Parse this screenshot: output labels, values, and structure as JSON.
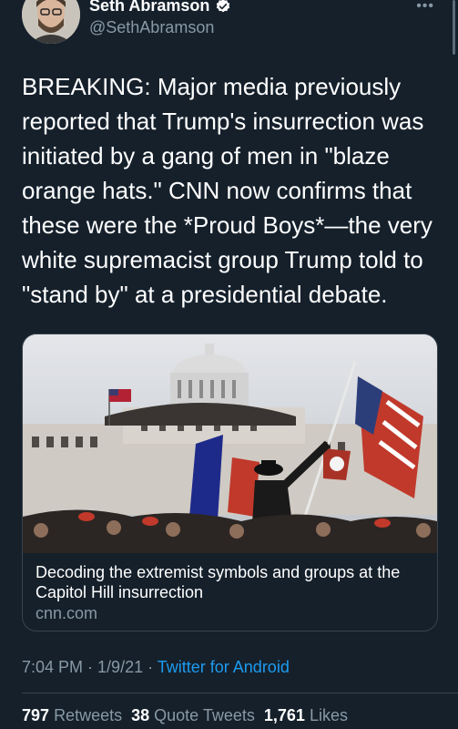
{
  "author": {
    "name": "Seth Abramson",
    "handle": "@SethAbramson"
  },
  "tweet": {
    "text": "BREAKING: Major media previously reported that Trump's insurrection was initiated by a gang of men in \"blaze orange hats.\" CNN now confirms that these were the *Proud Boys*—the very white supremacist group Trump told to \"stand by\" at a presidential debate."
  },
  "card": {
    "title": "Decoding the extremist symbols and groups at the Capitol Hill insurrection",
    "domain": "cnn.com"
  },
  "meta": {
    "time": "7:04 PM",
    "separator1": " · ",
    "date": "1/9/21",
    "separator2": " · ",
    "source": "Twitter for Android"
  },
  "stats": {
    "retweets_count": "797",
    "retweets_label": "Retweets",
    "quotes_count": "38",
    "quotes_label": "Quote Tweets",
    "likes_count": "1,761",
    "likes_label": "Likes"
  },
  "icons": {
    "verified": "verified-badge-icon",
    "more": "more-options-icon"
  },
  "colors": {
    "background": "#15202b",
    "secondary_text": "#8899a6",
    "link": "#1d9bf0",
    "border": "#38444d"
  }
}
